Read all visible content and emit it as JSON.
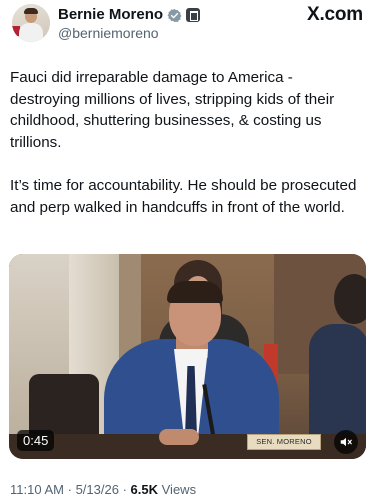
{
  "author": {
    "display_name": "Bernie Moreno",
    "handle": "@berniemoreno",
    "verified_icon": "verified-badge-icon",
    "affiliation_icon": "government-badge-icon"
  },
  "brand": {
    "logo_text": "X.com"
  },
  "tweet": {
    "paragraphs": [
      "Fauci did irreparable damage to America - destroying millions of lives, stripping kids of their childhood, shuttering businesses, & costing us trillions.",
      "It’s time for accountability. He should be prosecuted and perp walked in handcuffs in front of the world."
    ]
  },
  "media": {
    "type": "video",
    "duration": "0:45",
    "nameplate": "SEN. MORENO",
    "sound_icon": "speaker-muted-icon"
  },
  "meta": {
    "time": "11:10 AM",
    "separator": "·",
    "date": "5/13/26",
    "views_count": "6.5K",
    "views_label": "Views"
  },
  "colors": {
    "text_primary": "#0f1419",
    "text_secondary": "#536471",
    "verified_blue": "#8899a6",
    "background": "#ffffff"
  }
}
